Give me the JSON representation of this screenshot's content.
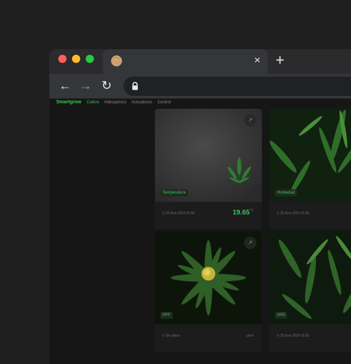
{
  "browser": {
    "tab_icon": "monkey-face-icon",
    "close_glyph": "×",
    "newtab_glyph": "+",
    "back_glyph": "←",
    "forward_glyph": "→",
    "reload_glyph": "↻"
  },
  "app": {
    "brand": "Smartgrow",
    "nav": [
      "Cultivo",
      "Hidroponico",
      "Actuadores",
      "Control"
    ],
    "accent": "#3ec45a"
  },
  "cards": [
    {
      "tag": "Temperatura",
      "date": "25 Ene 2024 15:56",
      "value": "19.65",
      "unit": "°C"
    },
    {
      "tag": "Humedad",
      "date": "25 Ene 2024 15:56",
      "value": "",
      "unit": ""
    },
    {
      "tag": "PPF",
      "date": "Sin datos",
      "value": "",
      "unit": "umol"
    },
    {
      "tag": "VPD",
      "date": "25 Ene 2024 15:56",
      "value": "",
      "unit": ""
    }
  ]
}
